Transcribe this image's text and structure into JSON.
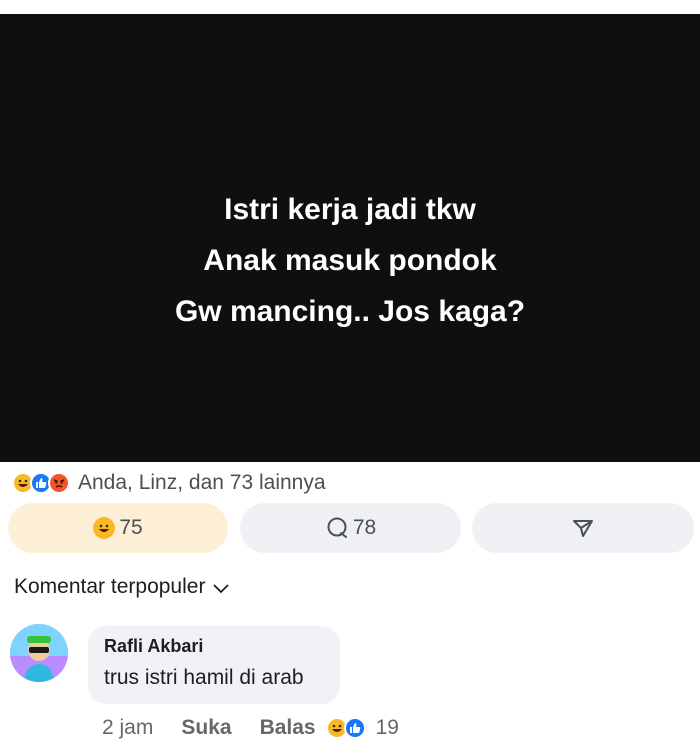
{
  "post": {
    "caption_lines": [
      "Istri kerja jadi tkw",
      "Anak masuk pondok",
      "Gw mancing.. Jos kaga?"
    ]
  },
  "reactions": {
    "summary_text": "Anda, Linz, dan 73 lainnya",
    "icons": [
      "haha-icon",
      "like-icon",
      "angry-icon"
    ]
  },
  "actions": {
    "react_count": "75",
    "comment_count": "78"
  },
  "comments_header": {
    "sort_label": "Komentar terpopuler"
  },
  "comment": {
    "author": "Rafli Akbari",
    "text": "trus istri hamil di arab",
    "time": "2 jam",
    "like_label": "Suka",
    "reply_label": "Balas",
    "reaction_count": "19"
  },
  "colors": {
    "post_background": "#0f0f10",
    "react_button_bg": "#fcefd6",
    "button_bg": "#eef0f4",
    "like_blue": "#1877f2",
    "haha_yellow": "#f7b928",
    "angry_orange": "#f1552d"
  }
}
